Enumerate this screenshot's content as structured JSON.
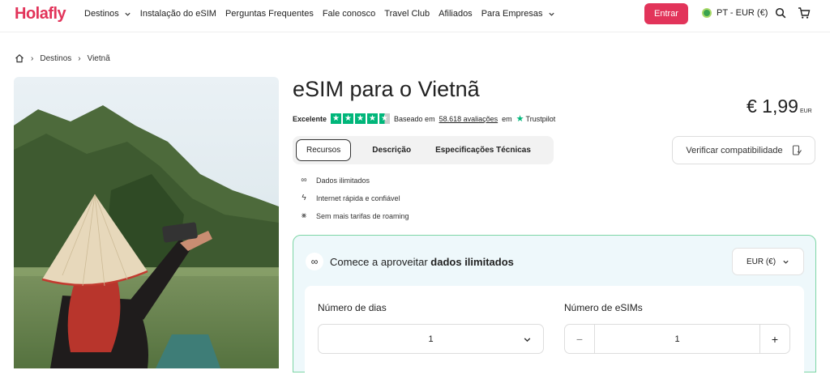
{
  "header": {
    "logo": "Holafly",
    "nav": [
      "Destinos",
      "Instalação do eSIM",
      "Perguntas Frequentes",
      "Fale conosco",
      "Travel Club",
      "Afiliados",
      "Para Empresas"
    ],
    "login_label": "Entrar",
    "locale_label": "PT - EUR (€)"
  },
  "breadcrumb": {
    "items": [
      "Destinos",
      "Vietnã"
    ]
  },
  "product": {
    "title": "eSIM para o Vietnã",
    "price": "€ 1,99",
    "price_currency": "EUR",
    "rating_label": "Excelente",
    "rating_stars": 4.5,
    "based_on": "Baseado em",
    "reviews_count": "58.618 avaliações",
    "on": "em",
    "trustpilot": "Trustpilot"
  },
  "tabs": [
    "Recursos",
    "Descrição",
    "Especificações Técnicas"
  ],
  "compat_label": "Verificar compatibilidade",
  "features": [
    "Dados ilimitados",
    "Internet rápida e confiável",
    "Sem mais tarifas de roaming"
  ],
  "plan": {
    "head_prefix": "Comece a aproveitar",
    "head_bold": "dados ilimitados",
    "currency_select": "EUR (€)",
    "days_label": "Número de dias",
    "days_value": "1",
    "esims_label": "Número de eSIMs",
    "esims_value": "1",
    "minus": "−",
    "plus": "+"
  },
  "colors": {
    "brand": "#e2345a",
    "trustpilot": "#00b67a",
    "panel_border": "#7dd6a5",
    "panel_bg": "#eef8fb"
  }
}
